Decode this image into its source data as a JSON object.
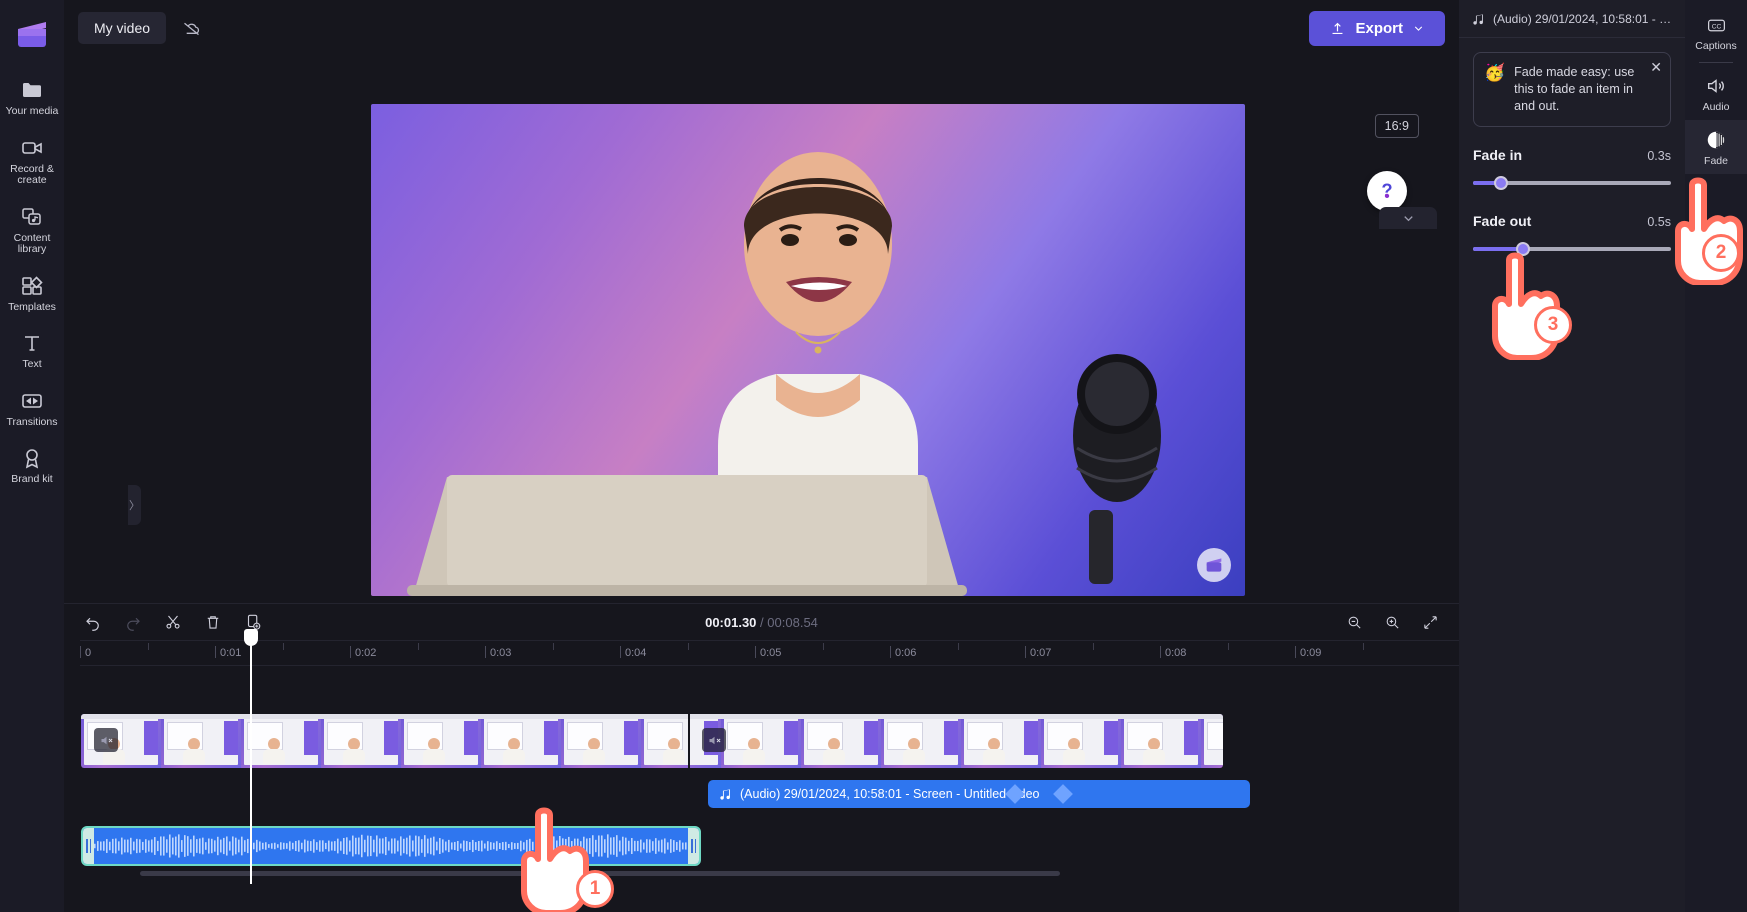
{
  "app": {
    "project_title": "My video",
    "cloud_icon": "cloud-off-icon",
    "export_label": "Export",
    "export_icon": "upload-icon",
    "accent_color": "#5b51d8",
    "audio_clip_color": "#2f76ef",
    "selection_color": "#6fd9c4",
    "annotation_color": "#ff6f5e"
  },
  "sidebar": {
    "logo": "clapperboard-logo",
    "items": [
      {
        "label": "Your media",
        "icon": "folder-icon"
      },
      {
        "label": "Record & create",
        "icon": "video-camera-icon"
      },
      {
        "label": "Content library",
        "icon": "content-library-icon"
      },
      {
        "label": "Templates",
        "icon": "templates-icon"
      },
      {
        "label": "Text",
        "icon": "text-icon"
      },
      {
        "label": "Transitions",
        "icon": "transitions-icon"
      },
      {
        "label": "Brand kit",
        "icon": "brand-kit-icon"
      }
    ]
  },
  "preview": {
    "ratio_badge": "16:9",
    "watermark": "clipchamp-watermark",
    "controls": [
      {
        "name": "captions-toggle",
        "icon": "captions-off-icon"
      },
      {
        "name": "skip-to-start",
        "icon": "skip-start-icon"
      },
      {
        "name": "rewind-5s",
        "icon": "rewind-5-icon"
      },
      {
        "name": "play",
        "icon": "play-icon"
      },
      {
        "name": "forward-5s",
        "icon": "forward-5-icon"
      },
      {
        "name": "skip-to-end",
        "icon": "skip-end-icon"
      },
      {
        "name": "fullscreen",
        "icon": "fullscreen-icon"
      }
    ],
    "help_glyph": "?"
  },
  "timeline": {
    "toolbar": [
      {
        "name": "undo",
        "icon": "undo-icon"
      },
      {
        "name": "redo",
        "icon": "redo-icon"
      },
      {
        "name": "split",
        "icon": "scissors-icon"
      },
      {
        "name": "delete",
        "icon": "trash-icon"
      },
      {
        "name": "duplicate",
        "icon": "duplicate-icon"
      }
    ],
    "current_time": "00:01.30",
    "total_time": "00:08.54",
    "time_separator": "/",
    "zoom_controls": [
      {
        "name": "zoom-out",
        "icon": "zoom-out-icon"
      },
      {
        "name": "zoom-in",
        "icon": "zoom-in-icon"
      },
      {
        "name": "fit-to-screen",
        "icon": "fit-screen-icon"
      }
    ],
    "ruler_ticks": [
      "0",
      "0:01",
      "0:02",
      "0:03",
      "0:04",
      "0:05",
      "0:06",
      "0:07",
      "0:08",
      "0:09"
    ],
    "audio_clip_label": "(Audio) 29/01/2024, 10:58:01 - Screen - Untitled video",
    "audio_clip_icon": "music-note-icon",
    "video_track_badge": "speaker-muted-icon"
  },
  "right_panel": {
    "header_title": "(Audio) 29/01/2024, 10:58:01 - S...",
    "header_icon": "music-note-icon",
    "tip": {
      "emoji": "🥳",
      "text": "Fade made easy: use this to fade an item in and out.",
      "close_icon": "close-icon"
    },
    "fade_in": {
      "label": "Fade in",
      "value": "0.3s",
      "percent": 14
    },
    "fade_out": {
      "label": "Fade out",
      "value": "0.5s",
      "percent": 25
    }
  },
  "right_rail": {
    "items": [
      {
        "label": "Captions",
        "icon": "captions-icon",
        "active": false
      },
      {
        "label": "Audio",
        "icon": "speaker-icon",
        "active": false
      },
      {
        "label": "Fade",
        "icon": "fade-icon",
        "active": true
      }
    ]
  },
  "annotations": [
    {
      "number": "1",
      "target": "audio-waveform-clip"
    },
    {
      "number": "2",
      "target": "right-rail-fade-tab"
    },
    {
      "number": "3",
      "target": "fade-out-slider"
    }
  ]
}
